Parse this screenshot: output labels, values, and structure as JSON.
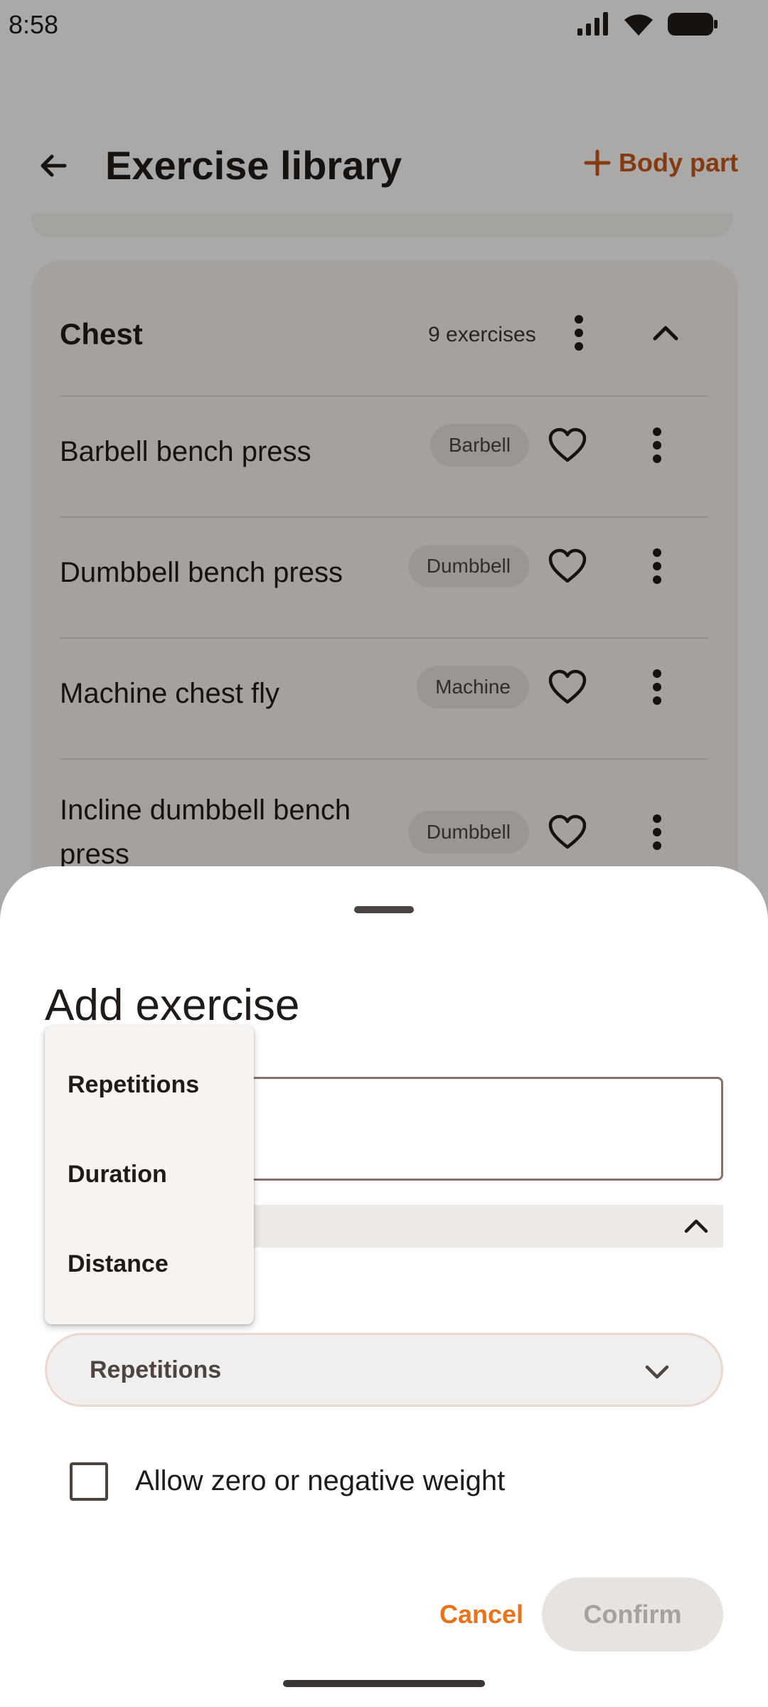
{
  "status_bar": {
    "time": "8:58"
  },
  "app_bar": {
    "title": "Exercise library",
    "action_label": "Body part"
  },
  "group": {
    "title": "Chest",
    "count": "9 exercises",
    "exercises": [
      {
        "name": "Barbell bench press",
        "equipment": "Barbell"
      },
      {
        "name": "Dumbbell bench press",
        "equipment": "Dumbbell"
      },
      {
        "name": "Machine chest fly",
        "equipment": "Machine"
      },
      {
        "name": "Incline dumbbell bench press",
        "equipment": "Dumbbell"
      }
    ]
  },
  "sheet": {
    "title": "Add exercise",
    "name_field": {
      "value": ""
    },
    "exercise_type": {
      "selected": "Repetitions"
    },
    "allow_zero_weight": {
      "label": "Allow zero or negative weight",
      "checked": false
    },
    "cancel_label": "Cancel",
    "confirm_label": "Confirm"
  },
  "type_menu": {
    "options": [
      "Repetitions",
      "Duration",
      "Distance"
    ]
  },
  "colors": {
    "accent": "#c4571b",
    "cancel": "#e8731a",
    "scrim": "rgba(0,0,0,0.32)"
  }
}
